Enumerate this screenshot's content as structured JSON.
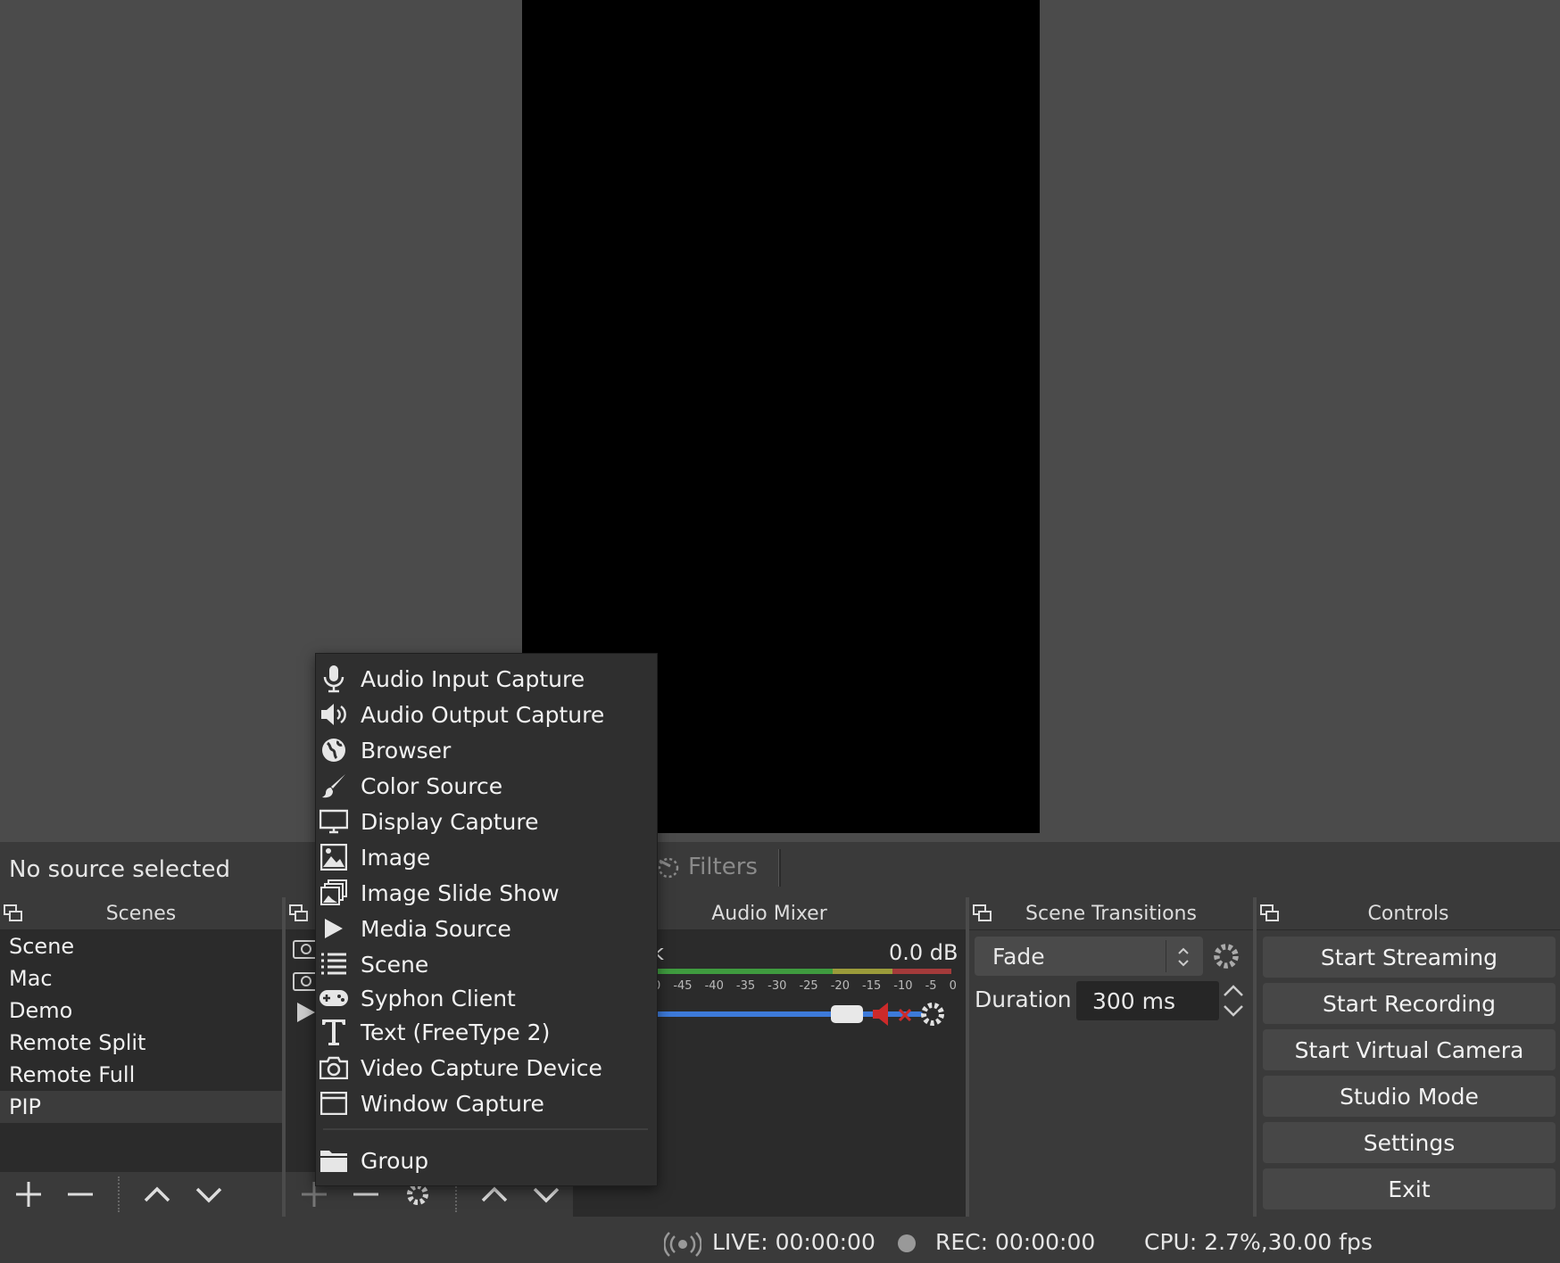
{
  "source_bar": {
    "no_source": "No source selected",
    "filters": "Filters"
  },
  "docks": {
    "scenes": {
      "title": "Scenes",
      "items": [
        "Scene",
        "Mac",
        "Demo",
        "Remote Split",
        "Remote Full",
        "PIP"
      ],
      "selected": "PIP"
    },
    "audio_mixer": {
      "title": "Audio Mixer",
      "channel_label": "k",
      "db": "0.0 dB",
      "ticks": [
        "0",
        "-45",
        "-40",
        "-35",
        "-30",
        "-25",
        "-20",
        "-15",
        "-10",
        "-5",
        "0"
      ]
    },
    "scene_transitions": {
      "title": "Scene Transitions",
      "transition": "Fade",
      "duration_label": "Duration",
      "duration_value": "300 ms"
    },
    "controls": {
      "title": "Controls",
      "buttons": [
        "Start Streaming",
        "Start Recording",
        "Start Virtual Camera",
        "Studio Mode",
        "Settings",
        "Exit"
      ]
    }
  },
  "context_menu": {
    "items": [
      {
        "label": "Audio Input Capture",
        "icon": "microphone-icon"
      },
      {
        "label": "Audio Output Capture",
        "icon": "speaker-icon"
      },
      {
        "label": "Browser",
        "icon": "globe-icon"
      },
      {
        "label": "Color Source",
        "icon": "paintbrush-icon"
      },
      {
        "label": "Display Capture",
        "icon": "monitor-icon"
      },
      {
        "label": "Image",
        "icon": "image-icon"
      },
      {
        "label": "Image Slide Show",
        "icon": "slideshow-icon"
      },
      {
        "label": "Media Source",
        "icon": "play-icon"
      },
      {
        "label": "Scene",
        "icon": "list-icon"
      },
      {
        "label": "Syphon Client",
        "icon": "gamepad-icon"
      },
      {
        "label": "Text (FreeType 2)",
        "icon": "text-icon"
      },
      {
        "label": "Video Capture Device",
        "icon": "camera-icon"
      },
      {
        "label": "Window Capture",
        "icon": "window-icon"
      }
    ],
    "group": {
      "label": "Group",
      "icon": "folder-icon"
    }
  },
  "status": {
    "live": "LIVE: 00:00:00",
    "rec": "REC: 00:00:00",
    "cpu": "CPU: 2.7%,30.00 fps"
  },
  "colors": {
    "accent_blue": "#3d7ad9",
    "mute_red": "#cc2a2a",
    "meter_green": "#3f9b3f",
    "meter_yellow": "#9b9b3a",
    "meter_red": "#a33a3a"
  }
}
